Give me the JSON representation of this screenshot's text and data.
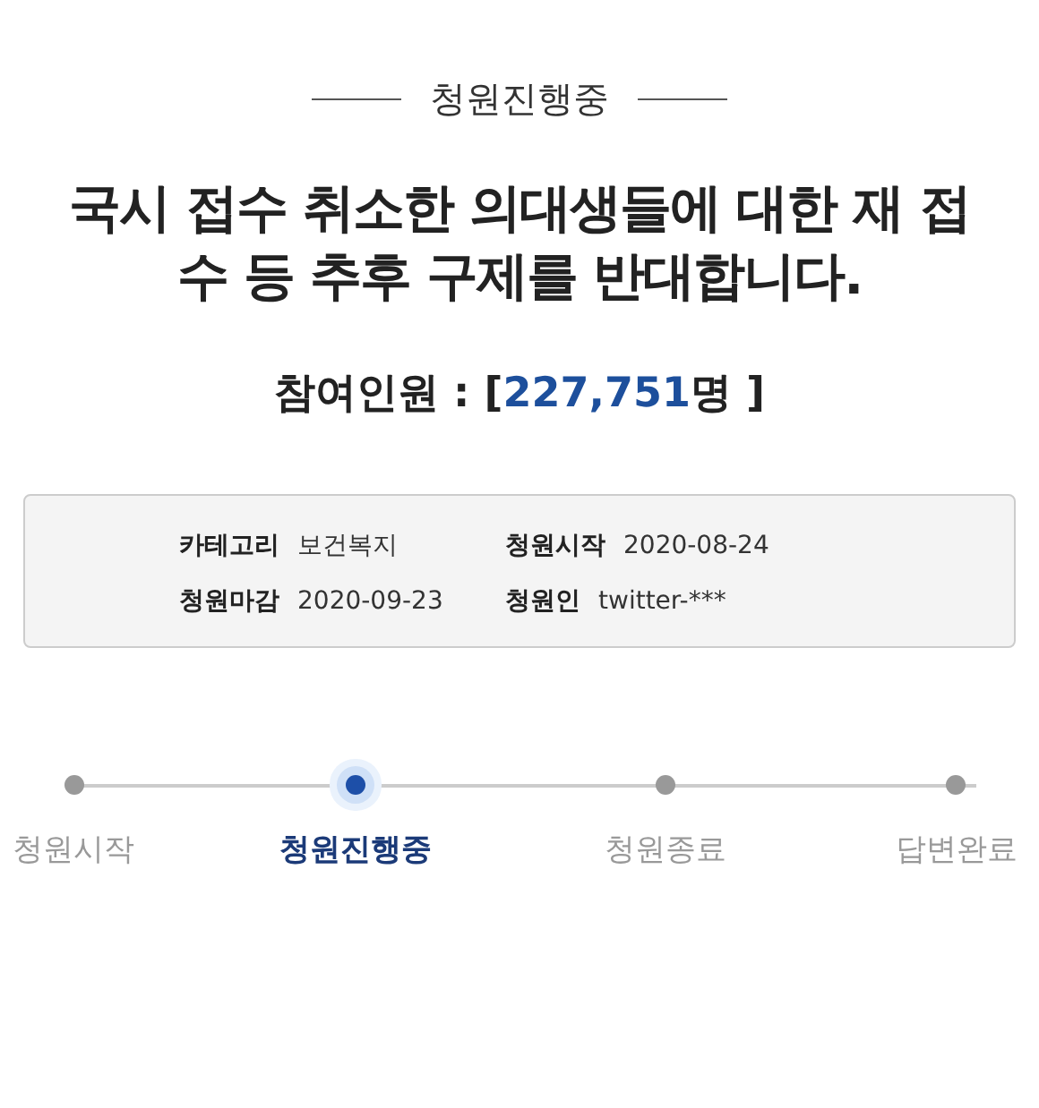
{
  "status_label": "청원진행중",
  "title": "국시 접수 취소한 의대생들에 대한 재 접수 등 추후 구제를 반대합니다.",
  "participants": {
    "prefix": "참여인원 : [",
    "count": "227,751",
    "suffix": "명 ]"
  },
  "info": [
    {
      "label": "카테고리",
      "value": "보건복지"
    },
    {
      "label": "청원시작",
      "value": "2020-08-24"
    },
    {
      "label": "청원마감",
      "value": "2020-09-23"
    },
    {
      "label": "청원인",
      "value": "twitter-***"
    }
  ],
  "steps": [
    {
      "label": "청원시작",
      "selected": false
    },
    {
      "label": "청원진행중",
      "selected": true
    },
    {
      "label": "청원종료",
      "selected": false
    },
    {
      "label": "답변완료",
      "selected": false
    }
  ]
}
